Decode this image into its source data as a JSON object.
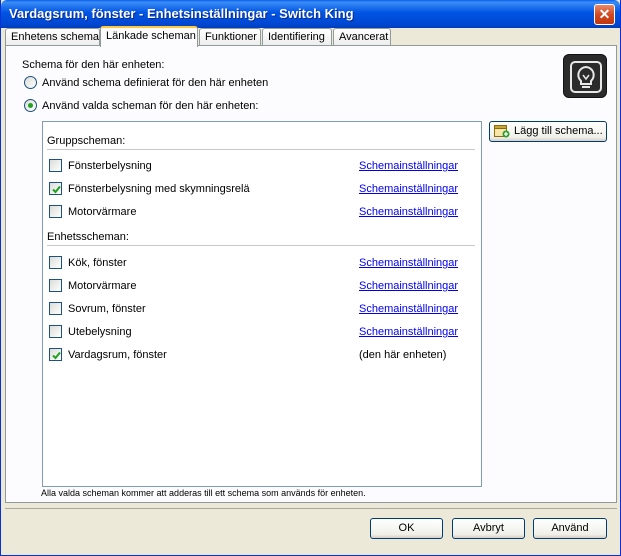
{
  "window": {
    "title": "Vardagsrum, fönster - Enhetsinställningar - Switch King",
    "close_label": "✕"
  },
  "tabs": [
    {
      "label": "Enhetens schema",
      "active": false
    },
    {
      "label": "Länkade scheman",
      "active": true
    },
    {
      "label": "Funktioner",
      "active": false
    },
    {
      "label": "Identifiering",
      "active": false
    },
    {
      "label": "Avancerat",
      "active": false
    }
  ],
  "schedule": {
    "heading": "Schema för den här enheten:",
    "option_own": "Använd schema definierat för den här enheten",
    "option_selected": "Använd valda scheman för den här enheten:",
    "selected_option": "option_selected"
  },
  "add_button": {
    "label": "Lägg till schema..."
  },
  "groups": {
    "group_header": "Gruppscheman:",
    "unit_header": "Enhetsscheman:",
    "group_items": [
      {
        "label": "Fönsterbelysning",
        "checked": false,
        "link": "Schemainställningar"
      },
      {
        "label": "Fönsterbelysning med skymningsrelä",
        "checked": true,
        "link": "Schemainställningar"
      },
      {
        "label": "Motorvärmare",
        "checked": false,
        "link": "Schemainställningar"
      }
    ],
    "unit_items": [
      {
        "label": "Kök, fönster",
        "checked": false,
        "link": "Schemainställningar"
      },
      {
        "label": "Motorvärmare",
        "checked": false,
        "link": "Schemainställningar"
      },
      {
        "label": "Sovrum, fönster",
        "checked": false,
        "link": "Schemainställningar"
      },
      {
        "label": "Utebelysning",
        "checked": false,
        "link": "Schemainställningar"
      },
      {
        "label": "Vardagsrum, fönster",
        "checked": true,
        "note": "(den här enheten)"
      }
    ]
  },
  "footer_note": "Alla valda scheman kommer att adderas till ett schema som används för enheten.",
  "buttons": {
    "ok": "OK",
    "cancel": "Avbryt",
    "apply": "Använd"
  },
  "colors": {
    "titlebar": "#0054e3",
    "check": "#21a121",
    "link": "#0000ee"
  }
}
